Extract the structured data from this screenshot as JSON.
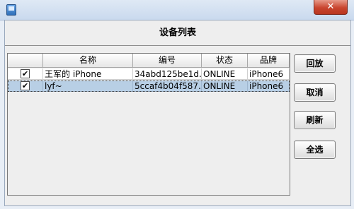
{
  "window": {
    "title": "",
    "close_glyph": "✕"
  },
  "dialog": {
    "title": "设备列表"
  },
  "table": {
    "columns": [
      "",
      "名称",
      "编号",
      "状态",
      "品牌"
    ],
    "rows": [
      {
        "checked": "✔",
        "name": "王军的 iPhone",
        "id": "34abd125be1d...",
        "status": "ONLINE",
        "brand": "iPhone6"
      },
      {
        "checked": "✔",
        "name": "lyf~",
        "id": "5ccaf4b04f587...",
        "status": "ONLINE",
        "brand": "iPhone6"
      }
    ],
    "selected_row": 1,
    "selected_row_color": "#b8cfe5"
  },
  "buttons": {
    "recover": "回放",
    "cancel": "取消",
    "refresh": "刷新",
    "select_all": "全选"
  },
  "icons": {
    "app": "app-icon",
    "close": "close-icon",
    "checkbox": "check-icon"
  }
}
